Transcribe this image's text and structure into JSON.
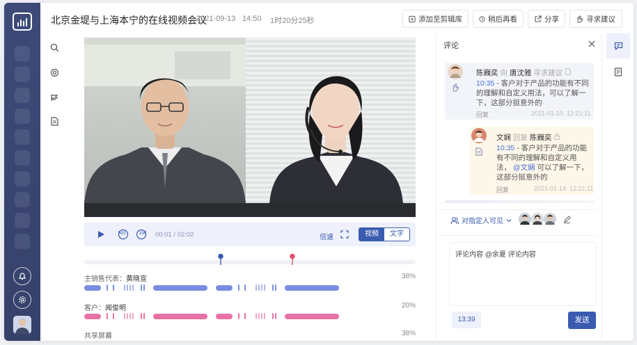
{
  "header": {
    "title": "北京金堤与上海本宁的在线视频会议",
    "date": "2021-09-13",
    "time": "14:50",
    "duration": "1时20分25秒",
    "buttons": {
      "add_to_clip": "添加至剪辑库",
      "watch_later": "稍后再看",
      "share": "分享",
      "seek_advice": "寻求建议"
    }
  },
  "player": {
    "time": "00:01 / 02:02",
    "speed_label": "倍速",
    "rewind_label": "15",
    "forward_label": "15",
    "toggle": {
      "video": "视频",
      "text": "文字",
      "active": "video"
    }
  },
  "speakers": [
    {
      "label": "主销售代表：",
      "name": "黄晓宣",
      "percent": "38%",
      "color": "#7b8ce0"
    },
    {
      "label": "客户：",
      "name": "闻俊明",
      "percent": "20%",
      "color": "#e872a4"
    },
    {
      "label": "共享屏幕",
      "name": "",
      "percent": "38%",
      "color": "#7b8ce0"
    }
  ],
  "comments": {
    "title": "评论",
    "items": [
      {
        "author": "陈巍奕",
        "relation": "向",
        "target": "唐沈雅",
        "action": "寻求建议",
        "timestamp_link": "10:35",
        "body": " - 客户对于产品的功能有不同的理解和自定义用法，可以了解一下，这部分挺意外的",
        "reply": "回复",
        "datetime": "2021-01-10  12:21:11"
      },
      {
        "author": "文娴",
        "relation": "回复",
        "target": "陈巍奕",
        "timestamp_link": "10:35",
        "body_a": " - 客户对于产品的功能有不同的理解和自定义用法，",
        "mention": "@文娴",
        "body_b": " 可以了解一下，这部分挺意外的",
        "reply": "回复",
        "datetime": "2021-01-14  12:21:11"
      }
    ],
    "visibility": "对指定人可见",
    "input_text": "评论内容 @余夏 评论内容",
    "timestamp_chip": "13:39",
    "send_label": "发送"
  },
  "colors": {
    "accent": "#4a6cd8",
    "rail": "#3d4a78",
    "speaker_blue": "#7b8ce0",
    "speaker_pink": "#e872a4",
    "marker_blue": "#3b5bb0",
    "marker_pink": "#e0506e"
  }
}
